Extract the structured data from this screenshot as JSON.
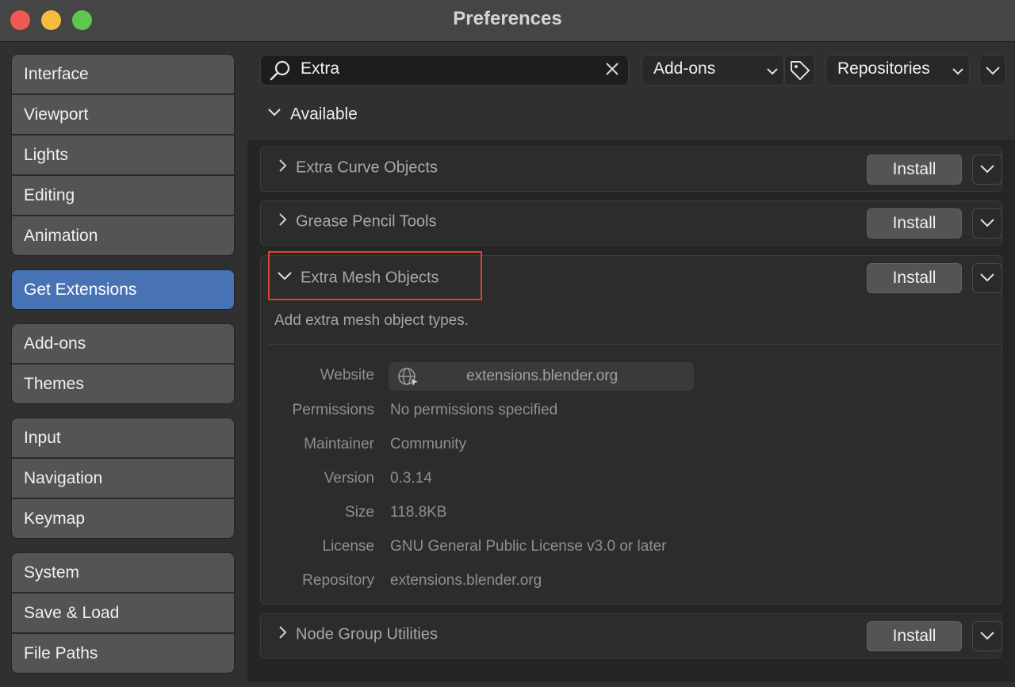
{
  "window": {
    "title": "Preferences"
  },
  "sidebar": {
    "groups": [
      {
        "items": [
          "Interface",
          "Viewport",
          "Lights",
          "Editing",
          "Animation"
        ]
      },
      {
        "items": [
          "Get Extensions"
        ]
      },
      {
        "items": [
          "Add-ons",
          "Themes"
        ]
      },
      {
        "items": [
          "Input",
          "Navigation",
          "Keymap"
        ]
      },
      {
        "items": [
          "System",
          "Save & Load",
          "File Paths"
        ]
      }
    ],
    "active": "Get Extensions"
  },
  "toolbar": {
    "search_value": "Extra",
    "type_filter": "Add-ons",
    "repositories": "Repositories"
  },
  "section": {
    "title": "Available"
  },
  "extensions": [
    {
      "name": "Extra Curve Objects",
      "install_label": "Install",
      "expanded": false
    },
    {
      "name": "Grease Pencil Tools",
      "install_label": "Install",
      "expanded": false
    },
    {
      "name": "Extra Mesh Objects",
      "install_label": "Install",
      "expanded": true,
      "description": "Add extra mesh object types.",
      "details": {
        "website_label": "Website",
        "website": "extensions.blender.org",
        "permissions_label": "Permissions",
        "permissions": "No permissions specified",
        "maintainer_label": "Maintainer",
        "maintainer": "Community",
        "version_label": "Version",
        "version": "0.3.14",
        "size_label": "Size",
        "size": "118.8KB",
        "license_label": "License",
        "license": "GNU General Public License v3.0 or later",
        "repository_label": "Repository",
        "repository": "extensions.blender.org"
      }
    },
    {
      "name": "Node Group Utilities",
      "install_label": "Install",
      "expanded": false
    }
  ],
  "colors": {
    "accent": "#4772b3",
    "highlight": "#d9452c"
  }
}
